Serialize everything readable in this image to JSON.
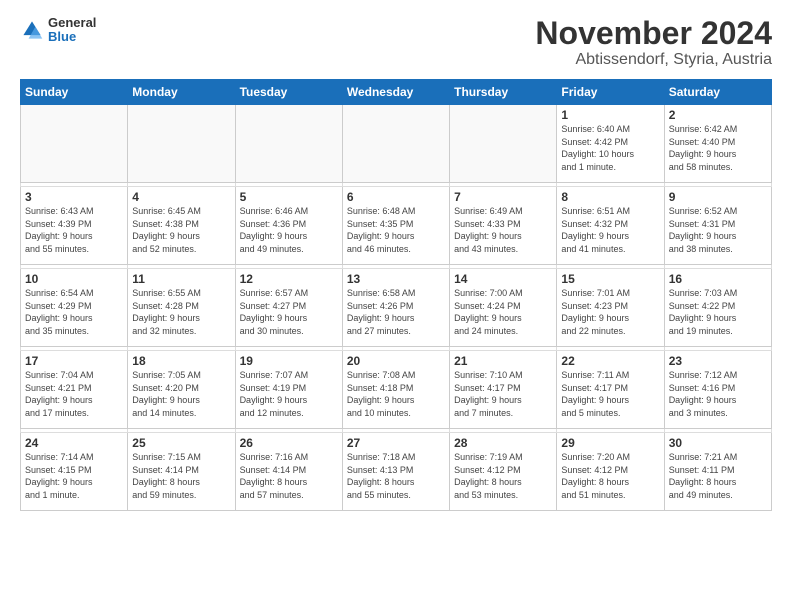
{
  "logo": {
    "general": "General",
    "blue": "Blue"
  },
  "title": "November 2024",
  "location": "Abtissendorf, Styria, Austria",
  "days_of_week": [
    "Sunday",
    "Monday",
    "Tuesday",
    "Wednesday",
    "Thursday",
    "Friday",
    "Saturday"
  ],
  "weeks": [
    [
      {
        "day": "",
        "info": ""
      },
      {
        "day": "",
        "info": ""
      },
      {
        "day": "",
        "info": ""
      },
      {
        "day": "",
        "info": ""
      },
      {
        "day": "",
        "info": ""
      },
      {
        "day": "1",
        "info": "Sunrise: 6:40 AM\nSunset: 4:42 PM\nDaylight: 10 hours\nand 1 minute."
      },
      {
        "day": "2",
        "info": "Sunrise: 6:42 AM\nSunset: 4:40 PM\nDaylight: 9 hours\nand 58 minutes."
      }
    ],
    [
      {
        "day": "3",
        "info": "Sunrise: 6:43 AM\nSunset: 4:39 PM\nDaylight: 9 hours\nand 55 minutes."
      },
      {
        "day": "4",
        "info": "Sunrise: 6:45 AM\nSunset: 4:38 PM\nDaylight: 9 hours\nand 52 minutes."
      },
      {
        "day": "5",
        "info": "Sunrise: 6:46 AM\nSunset: 4:36 PM\nDaylight: 9 hours\nand 49 minutes."
      },
      {
        "day": "6",
        "info": "Sunrise: 6:48 AM\nSunset: 4:35 PM\nDaylight: 9 hours\nand 46 minutes."
      },
      {
        "day": "7",
        "info": "Sunrise: 6:49 AM\nSunset: 4:33 PM\nDaylight: 9 hours\nand 43 minutes."
      },
      {
        "day": "8",
        "info": "Sunrise: 6:51 AM\nSunset: 4:32 PM\nDaylight: 9 hours\nand 41 minutes."
      },
      {
        "day": "9",
        "info": "Sunrise: 6:52 AM\nSunset: 4:31 PM\nDaylight: 9 hours\nand 38 minutes."
      }
    ],
    [
      {
        "day": "10",
        "info": "Sunrise: 6:54 AM\nSunset: 4:29 PM\nDaylight: 9 hours\nand 35 minutes."
      },
      {
        "day": "11",
        "info": "Sunrise: 6:55 AM\nSunset: 4:28 PM\nDaylight: 9 hours\nand 32 minutes."
      },
      {
        "day": "12",
        "info": "Sunrise: 6:57 AM\nSunset: 4:27 PM\nDaylight: 9 hours\nand 30 minutes."
      },
      {
        "day": "13",
        "info": "Sunrise: 6:58 AM\nSunset: 4:26 PM\nDaylight: 9 hours\nand 27 minutes."
      },
      {
        "day": "14",
        "info": "Sunrise: 7:00 AM\nSunset: 4:24 PM\nDaylight: 9 hours\nand 24 minutes."
      },
      {
        "day": "15",
        "info": "Sunrise: 7:01 AM\nSunset: 4:23 PM\nDaylight: 9 hours\nand 22 minutes."
      },
      {
        "day": "16",
        "info": "Sunrise: 7:03 AM\nSunset: 4:22 PM\nDaylight: 9 hours\nand 19 minutes."
      }
    ],
    [
      {
        "day": "17",
        "info": "Sunrise: 7:04 AM\nSunset: 4:21 PM\nDaylight: 9 hours\nand 17 minutes."
      },
      {
        "day": "18",
        "info": "Sunrise: 7:05 AM\nSunset: 4:20 PM\nDaylight: 9 hours\nand 14 minutes."
      },
      {
        "day": "19",
        "info": "Sunrise: 7:07 AM\nSunset: 4:19 PM\nDaylight: 9 hours\nand 12 minutes."
      },
      {
        "day": "20",
        "info": "Sunrise: 7:08 AM\nSunset: 4:18 PM\nDaylight: 9 hours\nand 10 minutes."
      },
      {
        "day": "21",
        "info": "Sunrise: 7:10 AM\nSunset: 4:17 PM\nDaylight: 9 hours\nand 7 minutes."
      },
      {
        "day": "22",
        "info": "Sunrise: 7:11 AM\nSunset: 4:17 PM\nDaylight: 9 hours\nand 5 minutes."
      },
      {
        "day": "23",
        "info": "Sunrise: 7:12 AM\nSunset: 4:16 PM\nDaylight: 9 hours\nand 3 minutes."
      }
    ],
    [
      {
        "day": "24",
        "info": "Sunrise: 7:14 AM\nSunset: 4:15 PM\nDaylight: 9 hours\nand 1 minute."
      },
      {
        "day": "25",
        "info": "Sunrise: 7:15 AM\nSunset: 4:14 PM\nDaylight: 8 hours\nand 59 minutes."
      },
      {
        "day": "26",
        "info": "Sunrise: 7:16 AM\nSunset: 4:14 PM\nDaylight: 8 hours\nand 57 minutes."
      },
      {
        "day": "27",
        "info": "Sunrise: 7:18 AM\nSunset: 4:13 PM\nDaylight: 8 hours\nand 55 minutes."
      },
      {
        "day": "28",
        "info": "Sunrise: 7:19 AM\nSunset: 4:12 PM\nDaylight: 8 hours\nand 53 minutes."
      },
      {
        "day": "29",
        "info": "Sunrise: 7:20 AM\nSunset: 4:12 PM\nDaylight: 8 hours\nand 51 minutes."
      },
      {
        "day": "30",
        "info": "Sunrise: 7:21 AM\nSunset: 4:11 PM\nDaylight: 8 hours\nand 49 minutes."
      }
    ]
  ]
}
